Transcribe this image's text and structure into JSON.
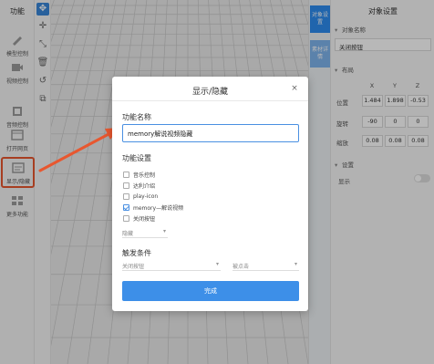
{
  "left_panel": {
    "title": "功能",
    "items": [
      {
        "label": "模型控制",
        "icon": "model-control-icon"
      },
      {
        "label": "视频控制",
        "icon": "video-control-icon"
      },
      {
        "label": "音频控制",
        "icon": "audio-control-icon"
      },
      {
        "label": "打开网页",
        "icon": "open-webpage-icon"
      },
      {
        "label": "显示/隐藏",
        "icon": "show-hide-icon"
      },
      {
        "label": "更多功能",
        "icon": "more-functions-icon"
      }
    ]
  },
  "toolbar": {
    "buttons": [
      "move-icon",
      "plus-icon",
      "scale-icon",
      "delete-icon",
      "undo-icon",
      "copy-icon"
    ]
  },
  "vtabs": [
    {
      "label": "对象设置"
    },
    {
      "label": "素材详情"
    }
  ],
  "right_panel": {
    "title": "对象设置",
    "object_name_section": "对象名称",
    "object_name_value": "关闭按钮",
    "layout_section": "布局",
    "axes": [
      "X",
      "Y",
      "Z"
    ],
    "rows": [
      {
        "label": "位置",
        "values": [
          "1.484",
          "1.898",
          "-0.53"
        ]
      },
      {
        "label": "旋转",
        "values": [
          "-90",
          "0",
          "0"
        ]
      },
      {
        "label": "缩放",
        "values": [
          "0.08",
          "0.08",
          "0.08"
        ]
      }
    ],
    "settings_section": "设置",
    "display_label": "显示",
    "display_on": false
  },
  "modal": {
    "title": "显示/隐藏",
    "close": "×",
    "function_name_label": "功能名称",
    "function_name_value": "memory解说视频隐藏",
    "function_settings_label": "功能设置",
    "options": [
      {
        "label": "音乐控制",
        "checked": false
      },
      {
        "label": "达利介绍",
        "checked": false
      },
      {
        "label": "play-icon",
        "checked": false
      },
      {
        "label": "memory—解说视频",
        "checked": true
      },
      {
        "label": "关闭按钮",
        "checked": false
      }
    ],
    "action_select": "隐藏",
    "trigger_label": "触发条件",
    "trigger_object": "关闭按钮",
    "trigger_event": "被点击",
    "done_label": "完成"
  },
  "colors": {
    "accent": "#3d8fe8",
    "highlight": "#e8572f"
  }
}
